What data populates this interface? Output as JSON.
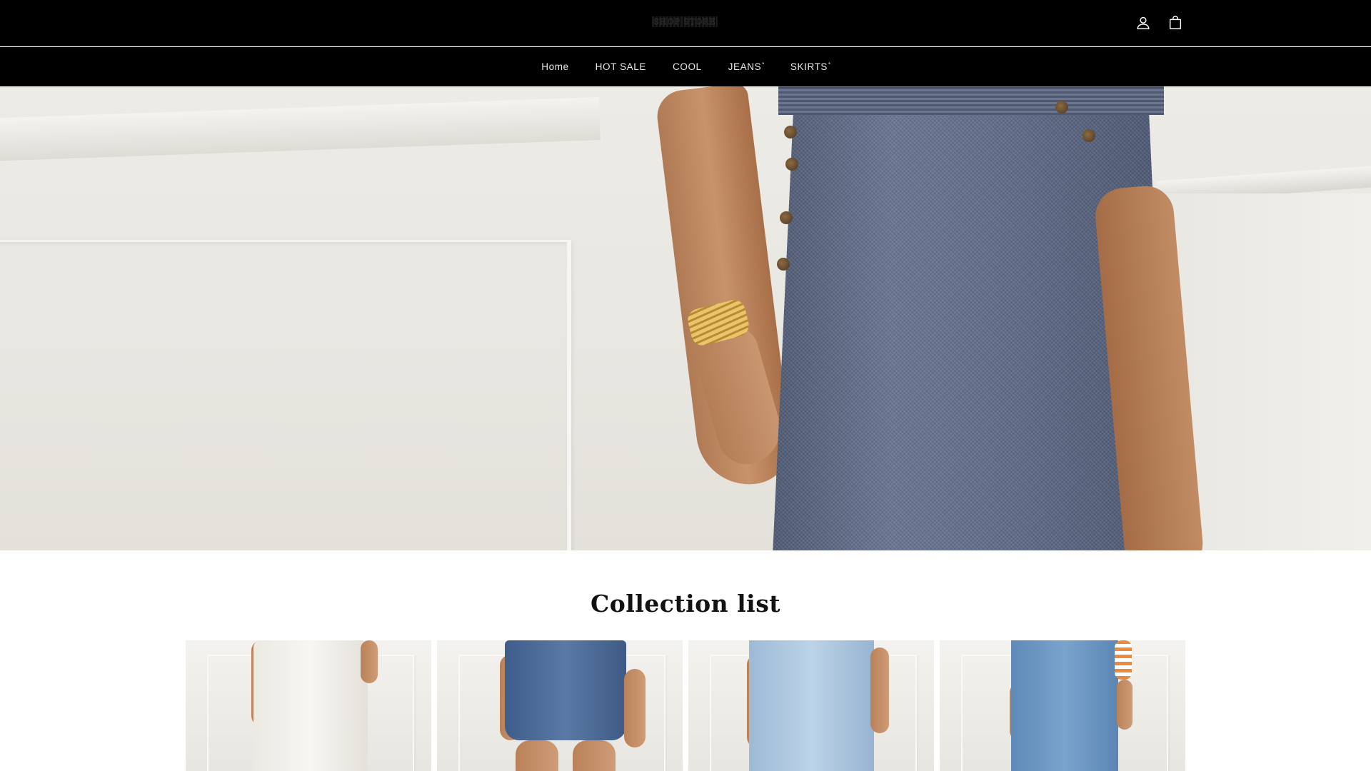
{
  "header": {
    "logo_text": "SHOP STORE",
    "icons": {
      "account": "account-icon",
      "cart": "bag-icon"
    }
  },
  "nav": {
    "items": [
      {
        "label": "Home",
        "marker": ""
      },
      {
        "label": "HOT SALE",
        "marker": ""
      },
      {
        "label": "COOL",
        "marker": ""
      },
      {
        "label": "JEANS",
        "marker": "*"
      },
      {
        "label": "SKIRTS",
        "marker": "*"
      }
    ]
  },
  "hero": {
    "image": "hero-banner-denim-skirt"
  },
  "collection": {
    "title": "Collection list",
    "cards": [
      {
        "image": "white-pants"
      },
      {
        "image": "denim-shorts"
      },
      {
        "image": "light-wide-leg-jeans"
      },
      {
        "image": "denim-button-skirt"
      }
    ]
  },
  "colors": {
    "header_bg": "#000000",
    "nav_text": "#e8e8e8",
    "page_bg": "#ffffff",
    "title_text": "#121212"
  }
}
